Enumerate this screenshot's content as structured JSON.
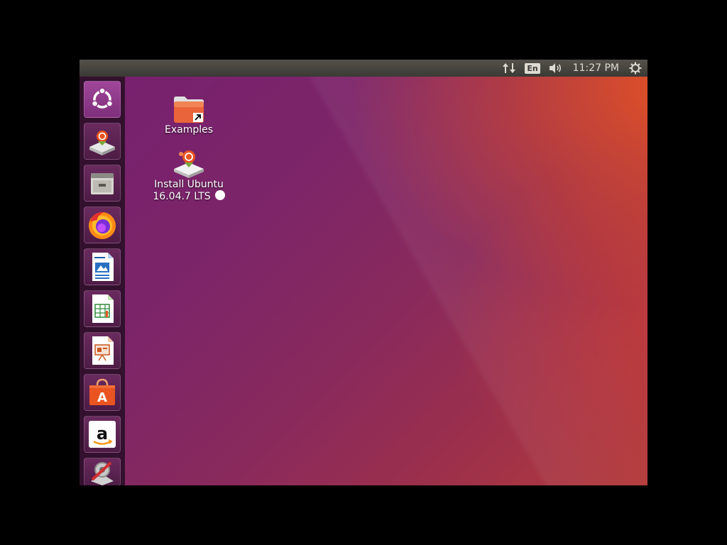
{
  "panel": {
    "language": "En",
    "clock": "11:27 PM",
    "icons": [
      "network-updown-icon",
      "volume-icon",
      "power-gear-icon"
    ]
  },
  "launcher": {
    "items": [
      {
        "name": "dash-home",
        "icon": "ubuntu-logo-icon"
      },
      {
        "name": "install-ubuntu",
        "icon": "installer-icon"
      },
      {
        "name": "files",
        "icon": "file-cabinet-icon"
      },
      {
        "name": "firefox",
        "icon": "firefox-icon"
      },
      {
        "name": "libreoffice-writer",
        "icon": "writer-document-icon"
      },
      {
        "name": "libreoffice-calc",
        "icon": "calc-spreadsheet-icon"
      },
      {
        "name": "libreoffice-impress",
        "icon": "impress-presentation-icon"
      },
      {
        "name": "ubuntu-software",
        "icon": "software-bag-icon"
      },
      {
        "name": "amazon",
        "icon": "amazon-icon"
      },
      {
        "name": "system-settings",
        "icon": "settings-icon"
      }
    ]
  },
  "desktop": {
    "icons": [
      {
        "label": "Examples",
        "icon": "folder-link-icon"
      },
      {
        "label_line1": "Install Ubuntu",
        "label_line2": "16.04.7 LTS",
        "icon": "installer-icon"
      }
    ]
  },
  "colors": {
    "accent_orange": "#e95420",
    "aubergine": "#77216f",
    "panel_bg": "#3c3b37"
  }
}
